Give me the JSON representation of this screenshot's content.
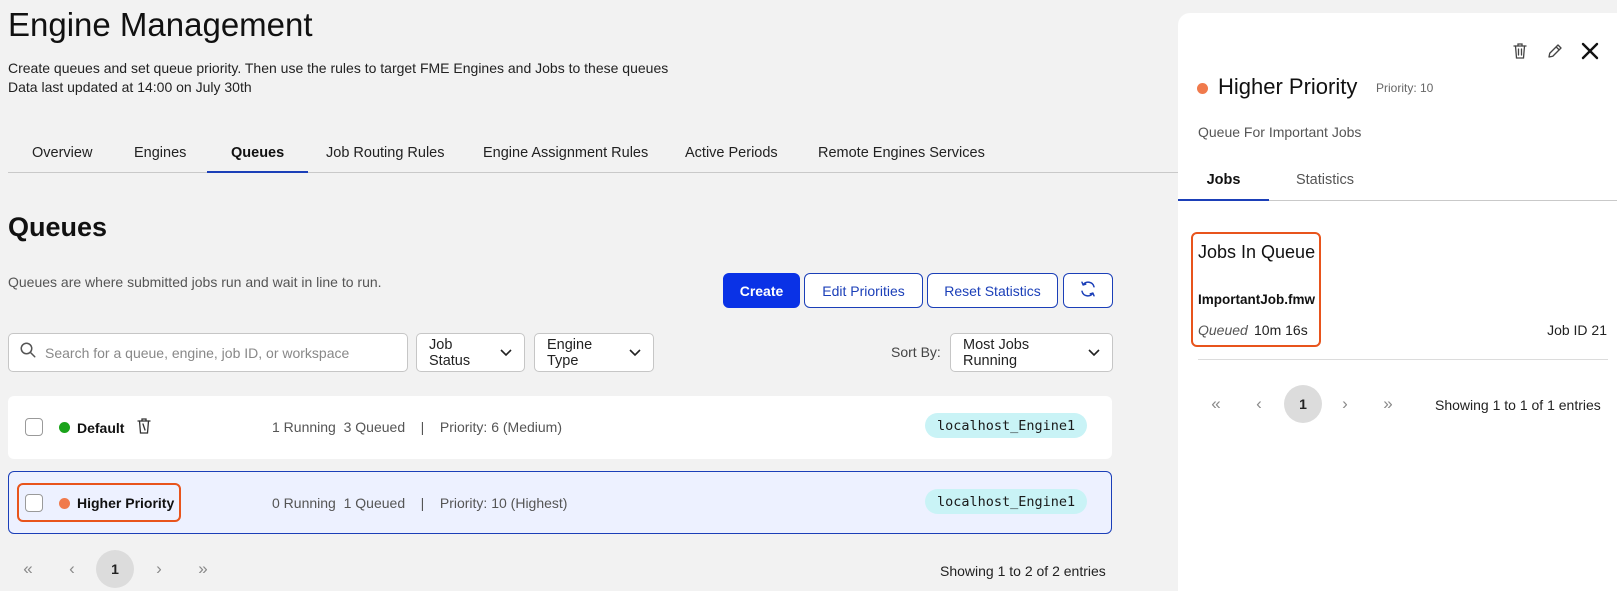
{
  "page": {
    "title": "Engine Management",
    "description": "Create queues and set queue priority. Then use the rules to target FME Engines and Jobs to these queues",
    "last_updated": "Data last updated at 14:00 on July 30th"
  },
  "tabs": [
    {
      "label": "Overview"
    },
    {
      "label": "Engines"
    },
    {
      "label": "Queues",
      "active": true
    },
    {
      "label": "Job Routing Rules"
    },
    {
      "label": "Engine Assignment Rules"
    },
    {
      "label": "Active Periods"
    },
    {
      "label": "Remote Engines Services"
    }
  ],
  "queues_section": {
    "title": "Queues",
    "description": "Queues are where submitted jobs run and wait in line to run.",
    "buttons": {
      "create": "Create",
      "edit_priorities": "Edit Priorities",
      "reset_statistics": "Reset Statistics",
      "refresh_icon": "refresh-icon"
    },
    "search_placeholder": "Search for a queue, engine, job ID, or workspace",
    "filters": {
      "job_status": "Job Status",
      "engine_type": "Engine Type"
    },
    "sort": {
      "label": "Sort By:",
      "value": "Most Jobs Running"
    }
  },
  "queues": [
    {
      "name": "Default",
      "status_color": "#1aa31a",
      "running": "1 Running",
      "queued": "3 Queued",
      "separator": "|",
      "priority": "Priority: 6 (Medium)",
      "engine": "localhost_Engine1",
      "has_trash_icon": true
    },
    {
      "name": "Higher Priority",
      "status_color": "#f07a4c",
      "running": "0 Running",
      "queued": "1 Queued",
      "separator": "|",
      "priority": "Priority: 10 (Highest)",
      "engine": "localhost_Engine1",
      "selected": true
    }
  ],
  "pagination": {
    "current_page": "1",
    "info": "Showing 1 to 2 of 2 entries"
  },
  "detail_panel": {
    "title": "Higher Priority",
    "status_color": "#f07a4c",
    "priority": "Priority: 10",
    "description": "Queue For Important Jobs",
    "tabs": [
      {
        "label": "Jobs",
        "active": true
      },
      {
        "label": "Statistics"
      }
    ],
    "jobs_heading": "Jobs In Queue",
    "jobs": [
      {
        "name": "ImportantJob.fmw",
        "status": "Queued",
        "time": "10m 16s",
        "id": "Job ID 21"
      }
    ],
    "pagination": {
      "current_page": "1",
      "info": "Showing 1 to 1 of 1 entries"
    },
    "icons": [
      "trash-icon",
      "pencil-icon",
      "close-icon"
    ]
  },
  "colors": {
    "accent": "#1b3fb8",
    "primary_button": "#0a32e6",
    "highlight": "#e8541c",
    "engine_chip": "#c9f3f6"
  }
}
